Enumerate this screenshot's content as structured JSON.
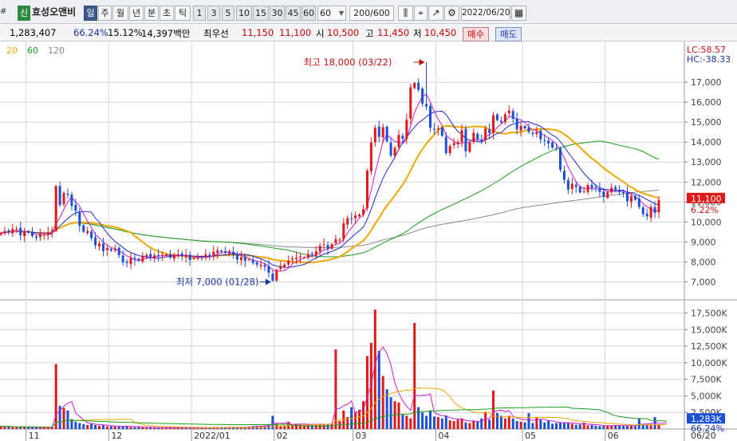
{
  "toolbar": {
    "hash_label": "#",
    "new_badge": "신",
    "stock_name": "효성오앤비",
    "periods": [
      "일",
      "주",
      "월",
      "년",
      "분",
      "초",
      "틱"
    ],
    "active_period": "일",
    "intervals": [
      "1",
      "3",
      "5",
      "10",
      "15",
      "30",
      "45",
      "60"
    ],
    "interval_select": "60",
    "count": "200/600",
    "date": "2022/06/20"
  },
  "quote": {
    "volume": "1,283,407",
    "vol_ratio": "66.24%",
    "turnover": "15.12%",
    "amount": "14,397백만",
    "best_ask_label": "최우선",
    "best_ask": "11,150",
    "best_bid": "11,100",
    "open_label": "시",
    "open": "10,500",
    "high_label": "고",
    "high": "11,450",
    "low_label": "저",
    "low": "10,450",
    "buy_label": "매수",
    "sell_label": "매도"
  },
  "colors": {
    "up": "#e01818",
    "down": "#1a4fd6",
    "ma5": "#d21ad2",
    "ma10": "#1a2ad8",
    "ma20": "#f0a800",
    "ma60": "#16a016",
    "ma120": "#888888",
    "grid": "#d4d4d4"
  },
  "chart_data": {
    "type": "candlestick",
    "legend": [
      "20",
      "60",
      "120"
    ],
    "corner_labels": {
      "lc": "LC:58.57",
      "hc": "HC:-38.33"
    },
    "price_axis": [
      "17,000",
      "16,000",
      "15,000",
      "14,000",
      "13,000",
      "12,000",
      "11,000",
      "10,000",
      "9,000",
      "8,000",
      "7,000"
    ],
    "price_range": [
      6100,
      18800
    ],
    "current_price_label": "11,100",
    "current_change_label": "6.22%",
    "volume_axis": [
      "17,500K",
      "15,000K",
      "12,500K",
      "10,000K",
      "7,500K",
      "5,000K",
      "2,500K"
    ],
    "volume_range": [
      0,
      19000
    ],
    "current_volume_label": "1,283K",
    "current_volume_ratio_label": "66.24%",
    "x_labels": [
      "11",
      "12",
      "2022/01",
      "02",
      "03",
      "04",
      "05",
      "06",
      "06/20"
    ],
    "annotations": {
      "high": "최고 18,000 (03/22)",
      "low": "최저 7,000 (01/28)"
    },
    "closes": [
      9440,
      9540,
      9480,
      9650,
      9660,
      9330,
      9520,
      9460,
      9300,
      9210,
      9400,
      9370,
      9480,
      9590,
      11800,
      10850,
      11450,
      11360,
      10800,
      10560,
      9810,
      9510,
      9540,
      9190,
      8830,
      8920,
      8540,
      8690,
      8560,
      8640,
      8340,
      7990,
      7950,
      8200,
      8120,
      8070,
      8270,
      8350,
      8230,
      8330,
      8290,
      8350,
      8370,
      8220,
      8360,
      8380,
      8280,
      8360,
      8100,
      8200,
      8230,
      8200,
      8380,
      8300,
      8510,
      8580,
      8500,
      8460,
      8510,
      8340,
      8120,
      8240,
      8050,
      8130,
      7950,
      7860,
      7860,
      7760,
      7460,
      7060,
      7600,
      7800,
      7860,
      8060,
      8170,
      8210,
      8280,
      8230,
      8390,
      8360,
      8530,
      8810,
      8880,
      8650,
      8890,
      9140,
      9120,
      9930,
      10190,
      10150,
      10330,
      10370,
      10640,
      12570,
      13980,
      14720,
      14260,
      14750,
      14040,
      13330,
      13710,
      14360,
      14170,
      15120,
      16740,
      16960,
      16620,
      15930,
      15780,
      14720,
      14640,
      14680,
      14320,
      13450,
      13800,
      13950,
      14000,
      14600,
      13540,
      13980,
      14470,
      14140,
      14080,
      14680,
      14460,
      15340,
      15100,
      14990,
      15390,
      15580,
      15170,
      14640,
      14810,
      14690,
      14510,
      14400,
      14520,
      14140,
      14060,
      13930,
      13720,
      13660,
      12620,
      12110,
      11620,
      11920,
      11760,
      11480,
      11540,
      11850,
      11700,
      11710,
      11500,
      11270,
      11500,
      11710,
      11630,
      11500,
      11450,
      11040,
      11290,
      11110,
      10750,
      10390,
      10280,
      10750,
      10450,
      11100
    ],
    "volumes": [
      420,
      350,
      380,
      300,
      250,
      320,
      280,
      300,
      260,
      240,
      200,
      210,
      230,
      260,
      9800,
      3500,
      3200,
      2800,
      1500,
      1100,
      900,
      750,
      620,
      800,
      610,
      500,
      580,
      400,
      420,
      380,
      350,
      450,
      480,
      300,
      280,
      300,
      260,
      250,
      240,
      210,
      200,
      230,
      220,
      260,
      180,
      210,
      250,
      230,
      200,
      180,
      190,
      200,
      210,
      230,
      240,
      300,
      220,
      260,
      240,
      280,
      250,
      230,
      320,
      380,
      450,
      500,
      430,
      520,
      620,
      2000,
      760,
      420,
      560,
      1100,
      600,
      800,
      700,
      650,
      760,
      650,
      680,
      800,
      700,
      780,
      820,
      12000,
      1200,
      2800,
      1800,
      3300,
      2600,
      2900,
      4200,
      11000,
      13000,
      18000,
      11800,
      8000,
      6000,
      4800,
      4200,
      4000,
      2200,
      2000,
      1600,
      16000,
      3300,
      2500,
      2000,
      2800,
      1900,
      1800,
      1600,
      2000,
      1300,
      1200,
      1400,
      1600,
      1000,
      900,
      1200,
      1100,
      1600,
      2600,
      1400,
      5800,
      2400,
      2000,
      1600,
      2000,
      1600,
      1200,
      1100,
      1000,
      2400,
      900,
      1700,
      1400,
      1000,
      1300,
      800,
      900,
      1000,
      900,
      1000,
      800,
      650,
      700,
      950,
      560,
      600,
      500,
      450,
      450,
      550,
      520,
      600,
      500,
      450,
      420,
      520,
      450,
      1600,
      700,
      600,
      600,
      1800,
      700,
      550,
      1283
    ]
  }
}
